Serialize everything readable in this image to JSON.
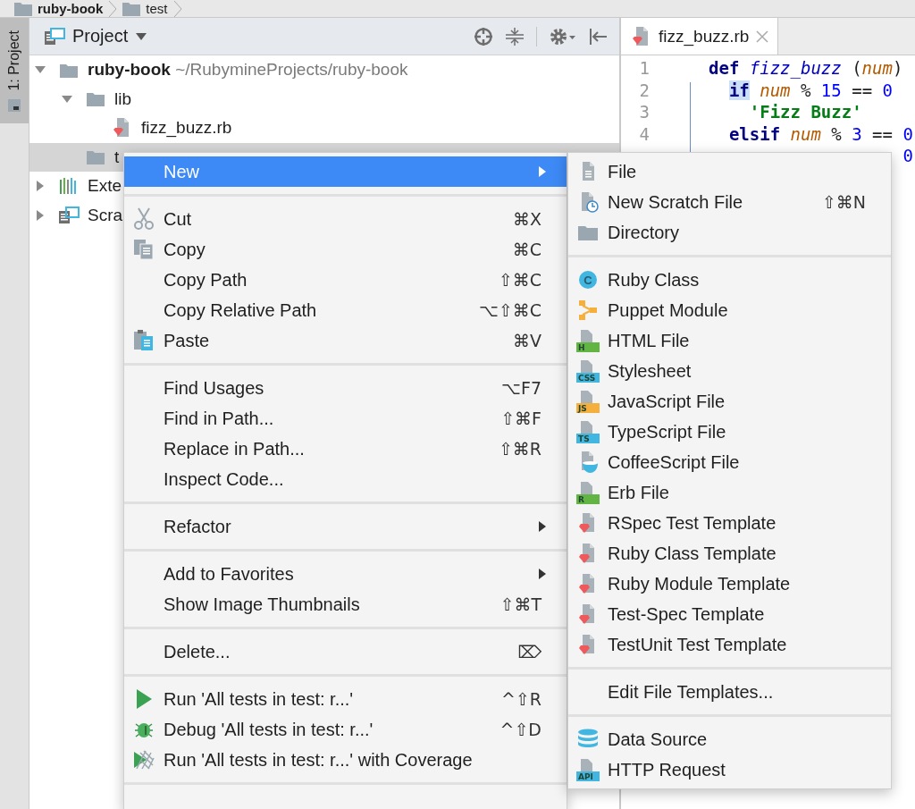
{
  "breadcrumbs": [
    {
      "label": "ruby-book"
    },
    {
      "label": "test"
    }
  ],
  "tool_strip": {
    "tab": {
      "label": "1: Project",
      "selected": true
    }
  },
  "project": {
    "title": "Project",
    "tree": [
      {
        "kind": "folder",
        "label": "ruby-book",
        "path": "~/RubymineProjects/ruby-book",
        "expanded": true,
        "selected": false,
        "children": [
          {
            "kind": "folder",
            "label": "lib",
            "expanded": true,
            "selected": false,
            "children": [
              {
                "kind": "ruby-file",
                "label": "fizz_buzz.rb",
                "selected": false
              }
            ]
          },
          {
            "kind": "folder",
            "label": "t",
            "selected": true
          }
        ]
      },
      {
        "kind": "library",
        "label": "Exte",
        "expanded": false,
        "selected": false
      },
      {
        "kind": "scratches",
        "label": "Scra",
        "expanded": false,
        "selected": false
      }
    ]
  },
  "editor": {
    "tabs": [
      {
        "label": "fizz_buzz.rb",
        "selected": true
      }
    ],
    "lines": [
      {
        "number": "1",
        "tokens": [
          {
            "text": "def",
            "kind": "keyword"
          },
          {
            "text": " fizz_buzz",
            "kind": "method"
          },
          {
            "text": " (",
            "kind": "plain"
          },
          {
            "text": "num",
            "kind": "param"
          },
          {
            "text": ")",
            "kind": "plain"
          }
        ],
        "children": [
          {
            "number": "2",
            "tokens": [
              {
                "text": "if",
                "kind": "keyword-match"
              },
              {
                "text": " num",
                "kind": "param"
              },
              {
                "text": " % ",
                "kind": "plain"
              },
              {
                "text": "15",
                "kind": "number"
              },
              {
                "text": " == ",
                "kind": "plain"
              },
              {
                "text": "0",
                "kind": "number"
              }
            ],
            "children": [
              {
                "number": "3",
                "tokens": [
                  {
                    "text": "'Fizz Buzz'",
                    "kind": "string"
                  }
                ]
              }
            ]
          },
          {
            "number": "4",
            "tokens": [
              {
                "text": "elsif",
                "kind": "keyword"
              },
              {
                "text": " num",
                "kind": "param"
              },
              {
                "text": " % ",
                "kind": "plain"
              },
              {
                "text": "3",
                "kind": "number"
              },
              {
                "text": " == ",
                "kind": "plain"
              },
              {
                "text": "0",
                "kind": "number"
              }
            ]
          }
        ]
      },
      {
        "kind": "line-end",
        "tokens": [
          {
            "text": "0",
            "kind": "number"
          }
        ]
      }
    ]
  },
  "context_menu": {
    "groups": [
      [
        {
          "label": "New",
          "selected": true,
          "submenu": true
        }
      ],
      [
        {
          "label": "Cut",
          "shortcut": "⌘X",
          "selected": false,
          "submenu": false
        },
        {
          "label": "Copy",
          "shortcut": "⌘C",
          "selected": false,
          "submenu": false
        },
        {
          "label": "Copy Path",
          "shortcut": "⇧⌘C",
          "selected": false,
          "submenu": false
        },
        {
          "label": "Copy Relative Path",
          "shortcut": "⌥⇧⌘C",
          "selected": false,
          "submenu": false
        },
        {
          "label": "Paste",
          "shortcut": "⌘V",
          "selected": false,
          "submenu": false
        }
      ],
      [
        {
          "label": "Find Usages",
          "shortcut": "⌥F7",
          "selected": false,
          "submenu": false
        },
        {
          "label": "Find in Path...",
          "shortcut": "⇧⌘F",
          "selected": false,
          "submenu": false
        },
        {
          "label": "Replace in Path...",
          "shortcut": "⇧⌘R",
          "selected": false,
          "submenu": false
        },
        {
          "label": "Inspect Code...",
          "selected": false,
          "submenu": false
        }
      ],
      [
        {
          "label": "Refactor",
          "selected": false,
          "submenu": true
        }
      ],
      [
        {
          "label": "Add to Favorites",
          "selected": false,
          "submenu": true
        },
        {
          "label": "Show Image Thumbnails",
          "shortcut": "⇧⌘T",
          "selected": false,
          "submenu": false
        }
      ],
      [
        {
          "label": "Delete...",
          "shortcut": "⌦",
          "selected": false,
          "submenu": false
        }
      ],
      [
        {
          "label": "Run 'All tests in test: r...'",
          "shortcut": "^⇧R",
          "selected": false,
          "submenu": false
        },
        {
          "label": "Debug 'All tests in test: r...'",
          "shortcut": "^⇧D",
          "selected": false,
          "submenu": false
        },
        {
          "label": "Run 'All tests in test: r...' with Coverage",
          "selected": false,
          "submenu": false
        }
      ]
    ]
  },
  "new_submenu": {
    "groups": [
      [
        {
          "label": "File",
          "selected": false
        },
        {
          "label": "New Scratch File",
          "shortcut": "⇧⌘N",
          "selected": false
        },
        {
          "label": "Directory",
          "selected": false
        }
      ],
      [
        {
          "label": "Ruby Class",
          "icon_text": "C",
          "selected": false
        },
        {
          "label": "Puppet Module",
          "selected": false
        },
        {
          "label": "HTML File",
          "icon_text": "H",
          "selected": false
        },
        {
          "label": "Stylesheet",
          "icon_text": "CSS",
          "selected": false
        },
        {
          "label": "JavaScript File",
          "icon_text": "JS",
          "selected": false
        },
        {
          "label": "TypeScript File",
          "icon_text": "TS",
          "selected": false
        },
        {
          "label": "CoffeeScript File",
          "selected": false
        },
        {
          "label": "Erb File",
          "icon_text": "R",
          "selected": false
        },
        {
          "label": "RSpec Test Template",
          "selected": false
        },
        {
          "label": "Ruby Class Template",
          "selected": false
        },
        {
          "label": "Ruby Module Template",
          "selected": false
        },
        {
          "label": "Test-Spec Template",
          "selected": false
        },
        {
          "label": "TestUnit Test Template",
          "selected": false
        }
      ],
      [
        {
          "label": "Edit File Templates...",
          "selected": false
        }
      ],
      [
        {
          "label": "Data Source",
          "selected": false
        },
        {
          "label": "HTTP Request",
          "icon_text": "API",
          "selected": false
        }
      ]
    ]
  }
}
